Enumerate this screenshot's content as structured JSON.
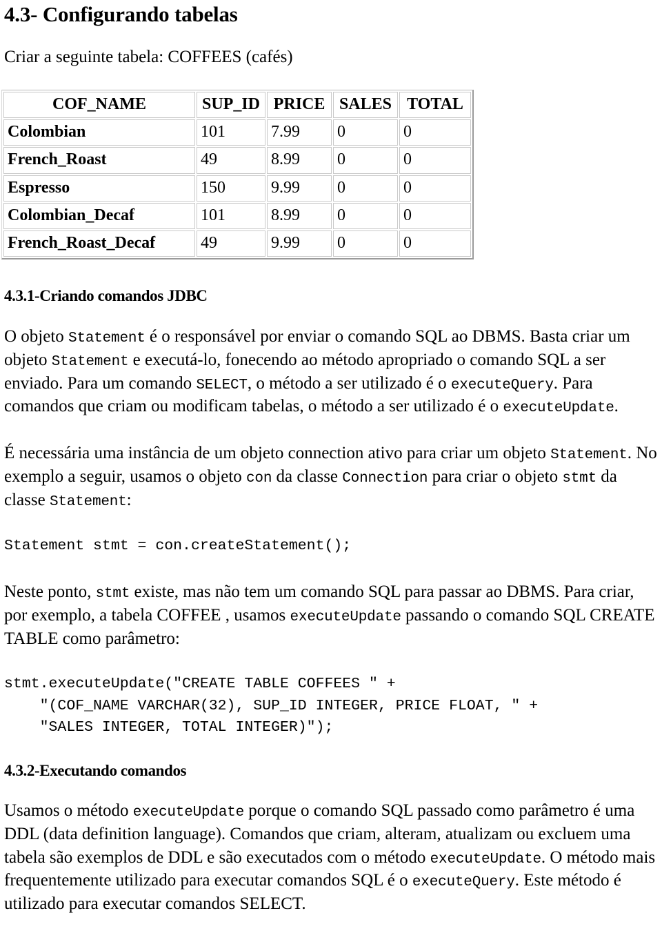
{
  "document": {
    "title": "4.3- Configurando tabelas",
    "intro": "Criar a seguinte tabela: COFFEES (cafés)"
  },
  "table": {
    "name": "coffees-table",
    "headers": [
      "COF_NAME",
      "SUP_ID",
      "PRICE",
      "SALES",
      "TOTAL"
    ],
    "rows": [
      [
        "Colombian",
        "101",
        "7.99",
        "0",
        "0"
      ],
      [
        "French_Roast",
        "49",
        "8.99",
        "0",
        "0"
      ],
      [
        "Espresso",
        "150",
        "9.99",
        "0",
        "0"
      ],
      [
        "Colombian_Decaf",
        "101",
        "8.99",
        "0",
        "0"
      ],
      [
        "French_Roast_Decaf",
        "49",
        "9.99",
        "0",
        "0"
      ]
    ]
  },
  "section_431": {
    "heading": "4.3.1-Criando comandos JDBC",
    "p1": {
      "t1": "O objeto ",
      "c1": "Statement",
      "t2": " é o responsável por enviar o comando SQL ao DBMS. Basta criar um objeto ",
      "c2": "Statement",
      "t3": " e executá-lo, fonecendo ao método apropriado o comando SQL a ser enviado. Para um comando ",
      "c3": "SELECT",
      "t4": ", o método a ser utilizado é o ",
      "c4": "executeQuery",
      "t5": ". Para comandos que criam ou modificam tabelas, o método a ser utilizado é o ",
      "c5": "executeUpdate",
      "t6": "."
    },
    "p2": {
      "t1": "É necessária uma instância de um objeto connection ativo para criar um objeto ",
      "c1": "Statement",
      "t2": ". No exemplo a seguir, usamos o objeto ",
      "c2": "con",
      "t3": " da classe ",
      "c3": "Connection",
      "t4": " para criar o objeto ",
      "c4": "stmt",
      "t5": " da classe ",
      "c5": "Statement",
      "t6": ":"
    },
    "code1": "Statement stmt = con.createStatement();",
    "p3": {
      "t1": "Neste ponto, ",
      "c1": "stmt",
      "t2": " existe, mas não tem um comando SQL para passar ao DBMS. Para criar, por exemplo, a tabela COFFEE , usamos ",
      "c2": "executeUpdate",
      "t3": " passando o comando SQL CREATE TABLE como parâmetro:"
    },
    "code2": "stmt.executeUpdate(\"CREATE TABLE COFFEES \" +\n    \"(COF_NAME VARCHAR(32), SUP_ID INTEGER, PRICE FLOAT, \" +\n    \"SALES INTEGER, TOTAL INTEGER)\");"
  },
  "section_432": {
    "heading": "4.3.2-Executando comandos",
    "p1": {
      "t1": "Usamos o método ",
      "c1": "executeUpdate",
      "t2": " porque o comando SQL passado como parâmetro é uma DDL (data definition language). Comandos que criam, alteram, atualizam ou excluem uma tabela são exemplos de DDL e são executados com o método ",
      "c2": "executeUpdate",
      "t3": ". O método mais frequentemente utilizado para executar comandos SQL é o ",
      "c3": "executeQuery",
      "t4": ". Este método é utilizado para executar comandos SELECT."
    }
  }
}
